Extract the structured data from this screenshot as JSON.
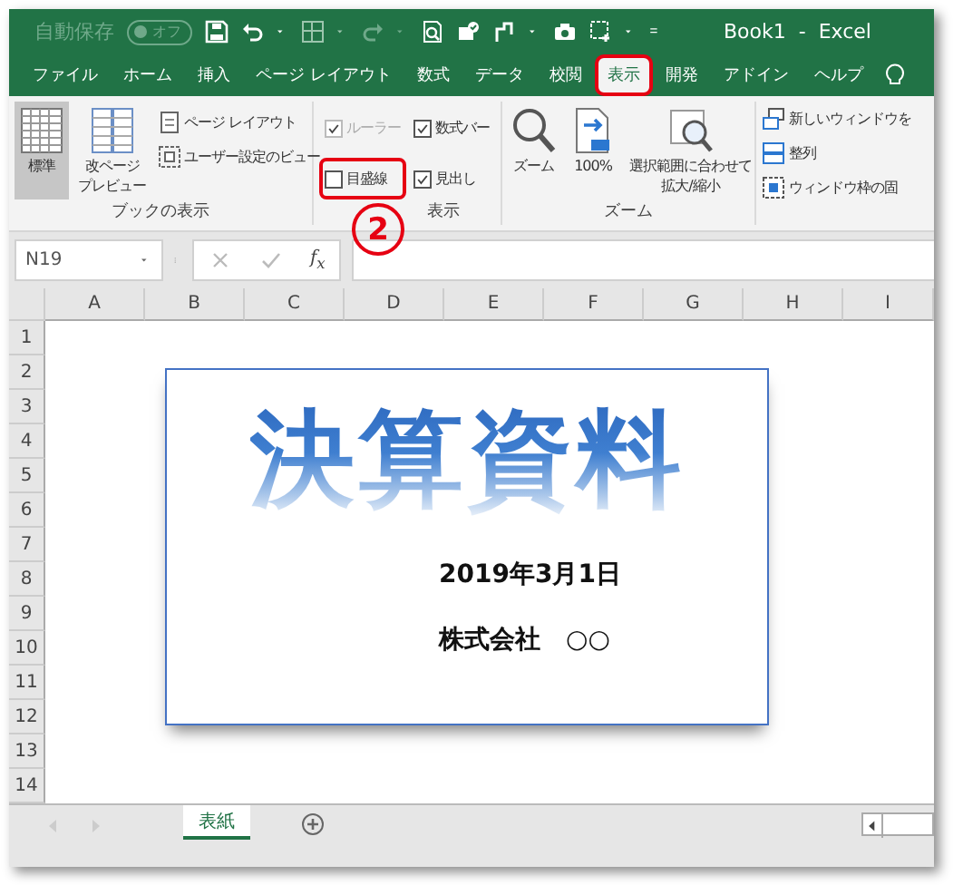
{
  "title_bar": {
    "autosave_label": "自動保存",
    "autosave_state": "オフ",
    "autosave_on": false,
    "title": "Book1  -  Excel"
  },
  "menu_tabs": [
    {
      "label": "ファイル",
      "selected": false,
      "highlighted": false
    },
    {
      "label": "ホーム",
      "selected": false,
      "highlighted": false
    },
    {
      "label": "挿入",
      "selected": false,
      "highlighted": false
    },
    {
      "label": "ページ レイアウト",
      "selected": false,
      "highlighted": false
    },
    {
      "label": "数式",
      "selected": false,
      "highlighted": false
    },
    {
      "label": "データ",
      "selected": false,
      "highlighted": false
    },
    {
      "label": "校閲",
      "selected": false,
      "highlighted": false
    },
    {
      "label": "表示",
      "selected": true,
      "highlighted": true
    },
    {
      "label": "開発",
      "selected": false,
      "highlighted": false
    },
    {
      "label": "アドイン",
      "selected": false,
      "highlighted": false
    },
    {
      "label": "ヘルプ",
      "selected": false,
      "highlighted": false
    }
  ],
  "ribbon": {
    "workbook_views": {
      "label": "ブックの表示",
      "buttons": [
        {
          "kind": "large",
          "lines": [
            "標準"
          ],
          "selected": true
        },
        {
          "kind": "large",
          "lines": [
            "改ページ",
            "プレビュー"
          ],
          "selected": false
        },
        {
          "kind": "small",
          "lines": [
            "ページ レイアウト"
          ],
          "selected": false
        },
        {
          "kind": "small",
          "lines": [
            "ユーザー設定のビュー"
          ],
          "selected": false
        }
      ]
    },
    "show": {
      "label": "表示",
      "checks": [
        {
          "label": "ルーラー",
          "checked": true,
          "disabled": true,
          "highlighted": false
        },
        {
          "label": "目盛線",
          "checked": false,
          "disabled": false,
          "highlighted": true
        },
        {
          "label": "数式バー",
          "checked": true,
          "disabled": false,
          "highlighted": false
        },
        {
          "label": "見出し",
          "checked": true,
          "disabled": false,
          "highlighted": false
        }
      ]
    },
    "zoom": {
      "label": "ズーム",
      "buttons": [
        {
          "lines": [
            "ズーム"
          ]
        },
        {
          "lines": [
            "100%"
          ]
        },
        {
          "lines": [
            "選択範囲に合わせて",
            "拡大/縮小"
          ]
        }
      ]
    },
    "window": {
      "buttons": [
        {
          "label": "新しいウィンドウを"
        },
        {
          "label": "整列"
        },
        {
          "label": "ウィンドウ枠の固"
        }
      ]
    }
  },
  "step_marker": "2",
  "formula_bar": {
    "name_box": "N19",
    "function_label": "f$_{x}$"
  },
  "sheet": {
    "columns": [
      "A",
      "B",
      "C",
      "D",
      "E",
      "F",
      "G",
      "H",
      "I"
    ],
    "rows": [
      "1",
      "2",
      "3",
      "4",
      "5",
      "6",
      "7",
      "8",
      "9",
      "10",
      "11",
      "12",
      "13",
      "14"
    ],
    "card": {
      "title": "決算資料",
      "date": "2019年3月1日",
      "company": "株式会社　○○"
    }
  },
  "sheet_tabs": [
    {
      "label": "表紙",
      "selected": true
    }
  ]
}
